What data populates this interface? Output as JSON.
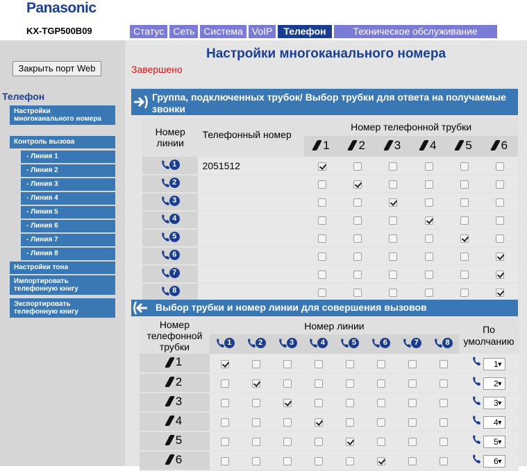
{
  "header": {
    "logo": "Panasonic",
    "model": "KX-TGP500B09",
    "tabs": [
      {
        "label": "Статус"
      },
      {
        "label": "Сеть"
      },
      {
        "label": "Система"
      },
      {
        "label": "VoIP"
      },
      {
        "label": "Телефон",
        "active": true
      },
      {
        "label": "Техническое обслуживание"
      }
    ]
  },
  "sidebar": {
    "close_port_button": "Закрыть порт Web",
    "section_title": "Телефон",
    "items": [
      {
        "label": "Настройки многоканального номера"
      },
      {
        "label": "Контроль вызова"
      },
      {
        "label": "- Линия 1"
      },
      {
        "label": "- Линия 2"
      },
      {
        "label": "- Линия 3"
      },
      {
        "label": "- Линия 4"
      },
      {
        "label": "- Линия 5"
      },
      {
        "label": "- Линия 6"
      },
      {
        "label": "- Линия 7"
      },
      {
        "label": "- Линия 8"
      },
      {
        "label": "Настройки тона"
      },
      {
        "label": "Импортировать телефонную книгу"
      },
      {
        "label": "Экспортировать телефонную книгу"
      }
    ]
  },
  "main": {
    "title": "Настройки многоканального номера",
    "status": "Завершено",
    "section1": {
      "title": "Группа, подключенных трубок/ Выбор трубки для ответа на получаемые звонки",
      "col_line": "Номер линии",
      "col_phone": "Телефонный номер",
      "col_handset": "Номер телефонной трубки",
      "handsets": [
        "1",
        "2",
        "3",
        "4",
        "5",
        "6"
      ],
      "rows": [
        {
          "line": "1",
          "phone": "2051512",
          "checks": [
            true,
            false,
            false,
            false,
            false,
            false
          ]
        },
        {
          "line": "2",
          "phone": "",
          "checks": [
            false,
            true,
            false,
            false,
            false,
            false
          ]
        },
        {
          "line": "3",
          "phone": "",
          "checks": [
            false,
            false,
            true,
            false,
            false,
            false
          ]
        },
        {
          "line": "4",
          "phone": "",
          "checks": [
            false,
            false,
            false,
            true,
            false,
            false
          ]
        },
        {
          "line": "5",
          "phone": "",
          "checks": [
            false,
            false,
            false,
            false,
            true,
            false
          ]
        },
        {
          "line": "6",
          "phone": "",
          "checks": [
            false,
            false,
            false,
            false,
            false,
            true
          ]
        },
        {
          "line": "7",
          "phone": "",
          "checks": [
            false,
            false,
            false,
            false,
            false,
            true
          ]
        },
        {
          "line": "8",
          "phone": "",
          "checks": [
            false,
            false,
            false,
            false,
            false,
            true
          ]
        }
      ]
    },
    "section2": {
      "title": "Выбор трубки и номер линии для совершения вызовов",
      "col_handset": "Номер телефонной трубки",
      "col_line": "Номер линии",
      "col_default": "По умолчанию",
      "lines": [
        "1",
        "2",
        "3",
        "4",
        "5",
        "6",
        "7",
        "8"
      ],
      "rows": [
        {
          "handset": "1",
          "checks": [
            true,
            false,
            false,
            false,
            false,
            false,
            false,
            false
          ],
          "default": "1"
        },
        {
          "handset": "2",
          "checks": [
            false,
            true,
            false,
            false,
            false,
            false,
            false,
            false
          ],
          "default": "2"
        },
        {
          "handset": "3",
          "checks": [
            false,
            false,
            true,
            false,
            false,
            false,
            false,
            false
          ],
          "default": "3"
        },
        {
          "handset": "4",
          "checks": [
            false,
            false,
            false,
            true,
            false,
            false,
            false,
            false
          ],
          "default": "4"
        },
        {
          "handset": "5",
          "checks": [
            false,
            false,
            false,
            false,
            true,
            false,
            false,
            false
          ],
          "default": "5"
        },
        {
          "handset": "6",
          "checks": [
            false,
            false,
            false,
            false,
            false,
            true,
            false,
            false
          ],
          "default": "6"
        }
      ]
    }
  }
}
